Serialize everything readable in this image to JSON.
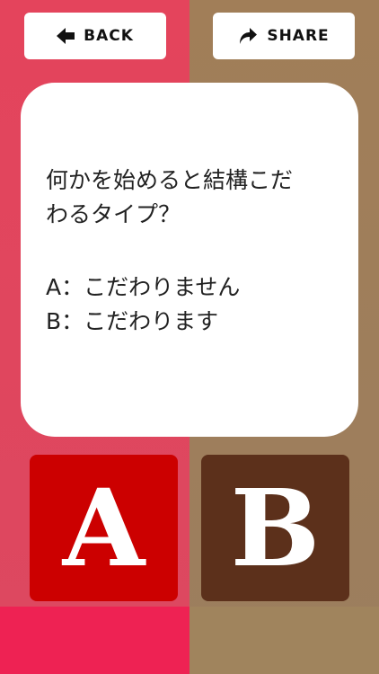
{
  "header": {
    "back_label": "BACK",
    "share_label": "SHARE"
  },
  "question": {
    "title_line1": "何かを始めると結構こだ",
    "title_line2": "わるタイプ？",
    "option_a": "A：こだわりません",
    "option_b": "B：こだわります"
  },
  "answers": {
    "a_label": "A",
    "b_label": "B"
  },
  "colors": {
    "left_panel": "#e4445c",
    "right_panel": "#a17e58",
    "answer_a": "#cc0000",
    "answer_b": "#5c301b",
    "bottom_left_bar": "#ee2253"
  }
}
